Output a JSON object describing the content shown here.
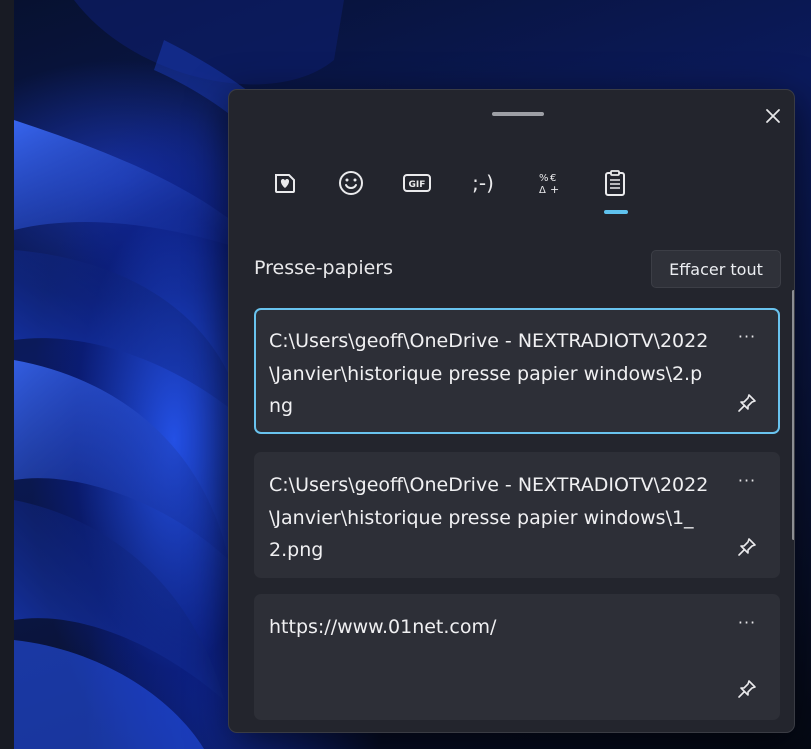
{
  "panel": {
    "close_label": "×"
  },
  "tabs": [
    {
      "name": "tab-kaomoji-heart",
      "icon": "heart-sticker-icon"
    },
    {
      "name": "tab-emoji",
      "icon": "smiley-icon"
    },
    {
      "name": "tab-gif",
      "icon": "gif-icon",
      "label": "GIF"
    },
    {
      "name": "tab-kaomoji",
      "icon": "kaomoji-icon",
      "label": ";-)"
    },
    {
      "name": "tab-symbols",
      "icon": "symbols-icon"
    },
    {
      "name": "tab-clipboard",
      "icon": "clipboard-icon",
      "active": true
    }
  ],
  "clipboard": {
    "title": "Presse-papiers",
    "clear_all_label": "Effacer tout",
    "items": [
      {
        "text": "C:\\Users\\geoff\\OneDrive - NEXTRADIOTV\\2022\\Janvier\\historique presse papier windows\\2.png",
        "selected": true,
        "more_label": "···"
      },
      {
        "text": "C:\\Users\\geoff\\OneDrive - NEXTRADIOTV\\2022\\Janvier\\historique presse papier windows\\1_2.png",
        "selected": false,
        "more_label": "···"
      },
      {
        "text": "https://www.01net.com/",
        "selected": false,
        "more_label": "···"
      }
    ]
  },
  "colors": {
    "panel_bg": "#23252d",
    "item_bg": "#2d2f37",
    "accent": "#5fc2ee",
    "text": "#f0f0f2"
  }
}
